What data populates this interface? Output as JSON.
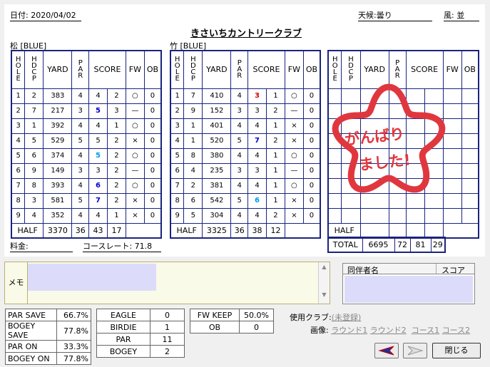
{
  "header": {
    "date_label": "日付:",
    "date": "2020/04/02",
    "course_name": "きさいちカントリークラブ",
    "weather_label": "天候:",
    "weather": "曇り",
    "wind_label": "風:",
    "wind": "並"
  },
  "columns": {
    "hole": "HOLE",
    "hdcp": "HDCP",
    "yard": "YARD",
    "par": "PAR",
    "score": "SCORE",
    "fw": "FW",
    "ob": "OB"
  },
  "round1": {
    "title": "松 [BLUE]",
    "rows": [
      {
        "hole": "1",
        "hdcp": "2",
        "yard": "383",
        "par": "4",
        "score": "4",
        "putt": "2",
        "fw": "○",
        "ob": "0",
        "style": ""
      },
      {
        "hole": "2",
        "hdcp": "7",
        "yard": "217",
        "par": "3",
        "score": "5",
        "putt": "3",
        "fw": "—",
        "ob": "0",
        "style": "b"
      },
      {
        "hole": "3",
        "hdcp": "1",
        "yard": "392",
        "par": "4",
        "score": "4",
        "putt": "1",
        "fw": "○",
        "ob": "0",
        "style": ""
      },
      {
        "hole": "4",
        "hdcp": "5",
        "yard": "529",
        "par": "5",
        "score": "5",
        "putt": "2",
        "fw": "×",
        "ob": "0",
        "style": ""
      },
      {
        "hole": "5",
        "hdcp": "6",
        "yard": "374",
        "par": "4",
        "score": "5",
        "putt": "2",
        "fw": "○",
        "ob": "0",
        "style": "lb"
      },
      {
        "hole": "6",
        "hdcp": "9",
        "yard": "149",
        "par": "3",
        "score": "3",
        "putt": "2",
        "fw": "—",
        "ob": "0",
        "style": ""
      },
      {
        "hole": "7",
        "hdcp": "8",
        "yard": "393",
        "par": "4",
        "score": "6",
        "putt": "2",
        "fw": "○",
        "ob": "0",
        "style": "b"
      },
      {
        "hole": "8",
        "hdcp": "3",
        "yard": "581",
        "par": "5",
        "score": "7",
        "putt": "2",
        "fw": "×",
        "ob": "0",
        "style": "b"
      },
      {
        "hole": "9",
        "hdcp": "4",
        "yard": "352",
        "par": "4",
        "score": "4",
        "putt": "1",
        "fw": "×",
        "ob": "0",
        "style": ""
      }
    ],
    "half": {
      "label": "HALF",
      "yard": "3370",
      "par": "36",
      "score": "43",
      "putt": "17"
    }
  },
  "round2": {
    "title": "竹 [BLUE]",
    "rows": [
      {
        "hole": "1",
        "hdcp": "7",
        "yard": "410",
        "par": "4",
        "score": "3",
        "putt": "1",
        "fw": "○",
        "ob": "0",
        "style": "r"
      },
      {
        "hole": "2",
        "hdcp": "9",
        "yard": "152",
        "par": "3",
        "score": "3",
        "putt": "2",
        "fw": "—",
        "ob": "0",
        "style": ""
      },
      {
        "hole": "3",
        "hdcp": "1",
        "yard": "401",
        "par": "4",
        "score": "4",
        "putt": "1",
        "fw": "×",
        "ob": "0",
        "style": ""
      },
      {
        "hole": "4",
        "hdcp": "1",
        "yard": "520",
        "par": "5",
        "score": "7",
        "putt": "2",
        "fw": "×",
        "ob": "0",
        "style": "b"
      },
      {
        "hole": "5",
        "hdcp": "8",
        "yard": "380",
        "par": "4",
        "score": "4",
        "putt": "1",
        "fw": "○",
        "ob": "0",
        "style": ""
      },
      {
        "hole": "6",
        "hdcp": "4",
        "yard": "235",
        "par": "3",
        "score": "3",
        "putt": "1",
        "fw": "—",
        "ob": "0",
        "style": ""
      },
      {
        "hole": "7",
        "hdcp": "2",
        "yard": "381",
        "par": "4",
        "score": "4",
        "putt": "1",
        "fw": "○",
        "ob": "0",
        "style": ""
      },
      {
        "hole": "8",
        "hdcp": "6",
        "yard": "542",
        "par": "5",
        "score": "6",
        "putt": "1",
        "fw": "×",
        "ob": "0",
        "style": "lb"
      },
      {
        "hole": "9",
        "hdcp": "5",
        "yard": "304",
        "par": "4",
        "score": "4",
        "putt": "2",
        "fw": "×",
        "ob": "0",
        "style": ""
      }
    ],
    "half": {
      "label": "HALF",
      "yard": "3325",
      "par": "36",
      "score": "38",
      "putt": "12"
    }
  },
  "round3": {
    "half_label": "HALF",
    "total_label": "TOTAL",
    "total": {
      "yard": "6695",
      "par": "72",
      "score": "81",
      "putt": "29"
    }
  },
  "stamp": {
    "line1": "がんばり",
    "line2": "ました!",
    "color": "#e0373f"
  },
  "fee": {
    "label": "料金:",
    "value": ""
  },
  "course_rate": {
    "label": "コースレート:",
    "value": "71.8"
  },
  "memo": {
    "label": "メモ",
    "value": ""
  },
  "companions": {
    "col_name": "同伴者名",
    "col_score": "スコア"
  },
  "stats1": [
    {
      "label": "PAR SAVE",
      "value": "66.7%"
    },
    {
      "label": "BOGEY SAVE",
      "value": "77.8%"
    },
    {
      "label": "PAR ON",
      "value": "33.3%"
    },
    {
      "label": "BOGEY ON",
      "value": "77.8%"
    }
  ],
  "stats2": [
    {
      "label": "EAGLE",
      "value": "0"
    },
    {
      "label": "BIRDIE",
      "value": "1"
    },
    {
      "label": "PAR",
      "value": "11"
    },
    {
      "label": "BOGEY",
      "value": "2"
    }
  ],
  "stats3": [
    {
      "label": "FW KEEP",
      "value": "50.0%"
    },
    {
      "label": "OB",
      "value": "0"
    }
  ],
  "clubs": {
    "label": "使用クラブ:",
    "value": "(未登録)"
  },
  "images": {
    "label": "画像:",
    "links": [
      "ラウンド1",
      "ラウンド2",
      "コース1",
      "コース2"
    ]
  },
  "buttons": {
    "close": "閉じる"
  }
}
